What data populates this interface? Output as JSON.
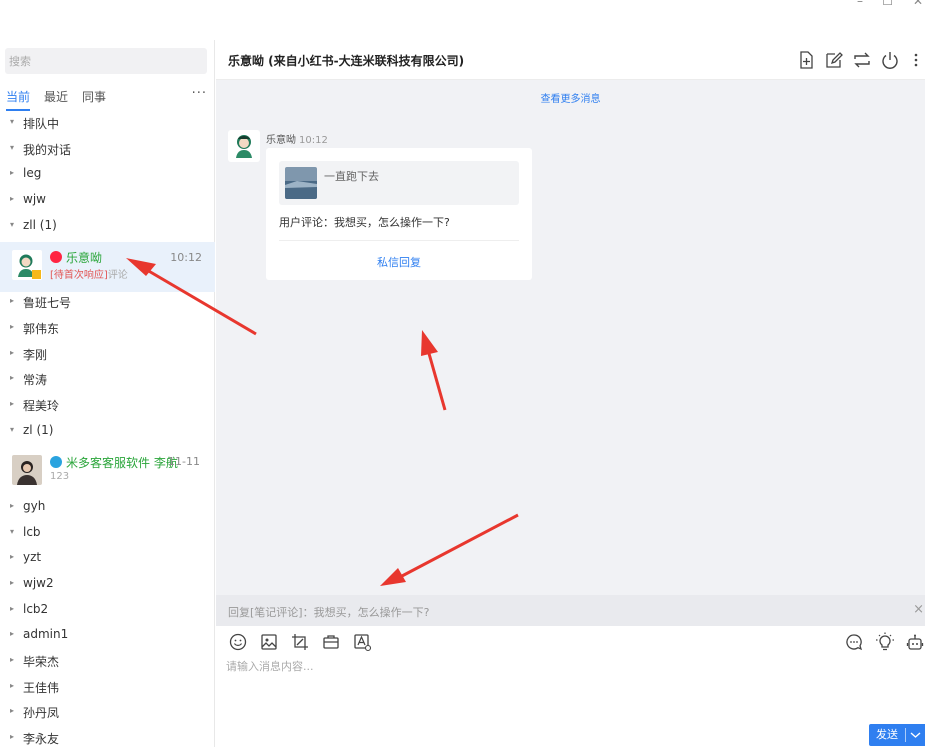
{
  "window": {
    "minimize_glyph": "–",
    "maximize_glyph": "☐",
    "close_glyph": "✕"
  },
  "sidebar": {
    "search_placeholder": "搜索",
    "tabs": [
      {
        "label": "当前",
        "active": true
      },
      {
        "label": "最近",
        "active": false
      },
      {
        "label": "同事",
        "active": false
      }
    ],
    "more_glyph": "···",
    "items": [
      {
        "type": "group",
        "label": "排队中",
        "expanded": true
      },
      {
        "type": "group",
        "label": "我的对话",
        "expanded": true
      },
      {
        "type": "group",
        "label": "leg",
        "expanded": false
      },
      {
        "type": "group",
        "label": "wjw",
        "expanded": false
      },
      {
        "type": "group",
        "label": "zll (1)",
        "expanded": true
      },
      {
        "type": "conversation",
        "name": "乐意呦",
        "time": "10:12",
        "preview_tag": "[待首次响应]",
        "preview_text": "评论",
        "platform": "xiaohongshu",
        "active": true
      },
      {
        "type": "group",
        "label": "鲁班七号",
        "expanded": false
      },
      {
        "type": "group",
        "label": "郭伟东",
        "expanded": false
      },
      {
        "type": "group",
        "label": "李刚",
        "expanded": false
      },
      {
        "type": "group",
        "label": "常涛",
        "expanded": false
      },
      {
        "type": "group",
        "label": "程美玲",
        "expanded": false
      },
      {
        "type": "group",
        "label": "zl (1)",
        "expanded": true
      },
      {
        "type": "conversation",
        "name": "米多客客服软件 李航",
        "time": "11-11",
        "preview_tag": "",
        "preview_text": "123",
        "platform": "telegram",
        "active": false
      },
      {
        "type": "group",
        "label": "gyh",
        "expanded": false
      },
      {
        "type": "group",
        "label": "lcb",
        "expanded": true
      },
      {
        "type": "group",
        "label": "yzt",
        "expanded": false
      },
      {
        "type": "group",
        "label": "wjw2",
        "expanded": false
      },
      {
        "type": "group",
        "label": "lcb2",
        "expanded": false
      },
      {
        "type": "group",
        "label": "admin1",
        "expanded": false
      },
      {
        "type": "group",
        "label": "毕荣杰",
        "expanded": false
      },
      {
        "type": "group",
        "label": "王佳伟",
        "expanded": false
      },
      {
        "type": "group",
        "label": "孙丹凤",
        "expanded": false
      },
      {
        "type": "group",
        "label": "李永友",
        "expanded": false
      }
    ]
  },
  "chat": {
    "title": "乐意呦 (来自小红书-大连米联科技有限公司)",
    "header_icons": [
      "add-note-icon",
      "edit-icon",
      "transfer-icon",
      "power-icon",
      "more-vertical-icon"
    ],
    "load_more": "查看更多消息",
    "message": {
      "sender": "乐意呦",
      "time": "10:12",
      "note_title": "一直跑下去",
      "comment": "用户评论：我想买，怎么操作一下?",
      "reply_action": "私信回复"
    },
    "reply_bar_text": "回复[笔记评论]：我想买，怎么操作一下?",
    "reply_close": "×",
    "composer_placeholder": "请输入消息内容...",
    "toolbar_icons": [
      "emoji-icon",
      "image-icon",
      "screenshot-icon",
      "toolbox-icon",
      "font-icon"
    ],
    "right_toolbar_icons": [
      "quick-reply-icon",
      "lightbulb-icon",
      "robot-icon"
    ],
    "send_label": "发送"
  },
  "colors": {
    "accent": "#2f7ff0",
    "online_green": "#2aa53a",
    "pending_red": "#e25555",
    "annotation_arrow": "#e8372e",
    "xiaohongshu_badge": "#ff2442",
    "telegram_badge": "#2aa3df"
  }
}
